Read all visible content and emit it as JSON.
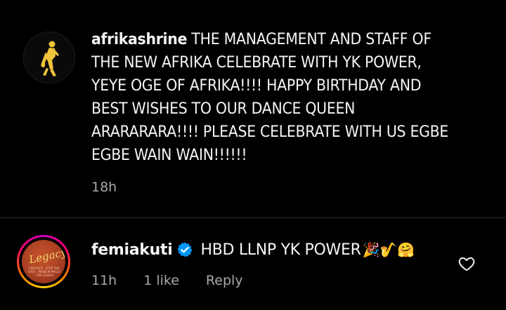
{
  "caption": {
    "username": "afrikashrine",
    "text": "THE MANAGEMENT AND STAFF OF THE NEW AFRIKA CELEBRATE WITH YK POWER, YEYE OGE OF AFRIKA!!!! HAPPY BIRTHDAY AND BEST WISHES TO OUR DANCE QUEEN ARARARARA!!!! PLEASE CELEBRATE WITH US EGBE EGBE WAIN WAIN!!!!!!",
    "time": "18h"
  },
  "comment": {
    "username": "femiakuti",
    "text": "HBD LLNP YK POWER",
    "emojis": "🎉🎷🤗",
    "time": "11h",
    "likes": "1 like",
    "reply_label": "Reply",
    "avatar_logo_text": "Legacy",
    "avatar_fine_text": "FEMI KUTI · STOP THE HATE · MADE IN PHILLY · THE LEGACY"
  },
  "colors": {
    "background": "#000000",
    "text": "#f5f5f5",
    "secondary": "#a8a8a8",
    "verified": "#0095f6"
  },
  "icons": {
    "verified": "verified-badge-icon",
    "like": "heart-outline-icon"
  }
}
